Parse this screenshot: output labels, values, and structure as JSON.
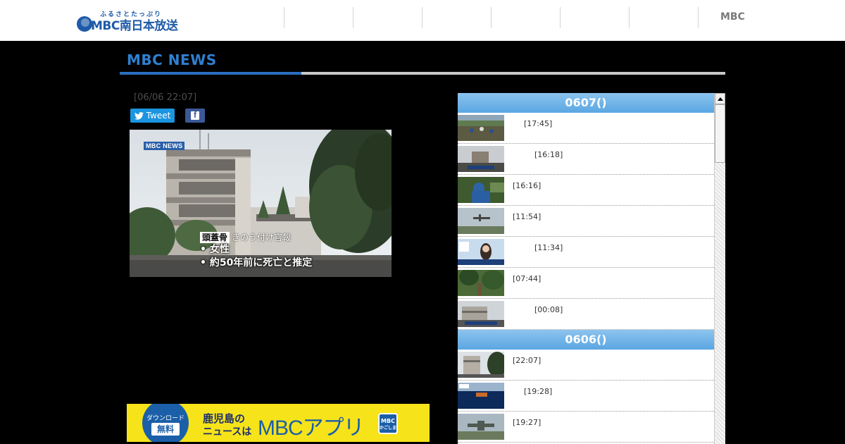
{
  "header": {
    "logo_tagline": "ふるさとたっぷり",
    "logo_name": "MBC南日本放送",
    "nav_mbc_label": "MBC"
  },
  "section": {
    "title": "MBC NEWS"
  },
  "article": {
    "date": "[06/06 22:07]",
    "tweet_label": "Tweet",
    "hero": {
      "logo_text": "MBC NEWS",
      "caption_title": "頭蓋骨",
      "caption_sub": "きのう付け官報",
      "bullet_1": "• 女性",
      "bullet_2": "• 約50年前に死亡と推定"
    }
  },
  "banner": {
    "download": "ダウンロード",
    "free": "無料",
    "line1": "鹿児島の",
    "line2": "ニュースは",
    "app": "MBCアプリ",
    "badge_top": "MBC",
    "badge_bottom": "かごしま"
  },
  "news_list": {
    "groups": [
      {
        "date": "0607()",
        "items": [
          {
            "time": "[17:45]",
            "thumb": "field"
          },
          {
            "time": "[16:18]",
            "thumb": "town"
          },
          {
            "time": "[16:16]",
            "thumb": "worker"
          },
          {
            "time": "[11:54]",
            "thumb": "plane"
          },
          {
            "time": "[11:34]",
            "thumb": "studio"
          },
          {
            "time": "[07:44]",
            "thumb": "forest"
          },
          {
            "time": "[00:08]",
            "thumb": "school"
          }
        ]
      },
      {
        "date": "0606()",
        "items": [
          {
            "time": "[22:07]",
            "thumb": "building"
          },
          {
            "time": "[19:28]",
            "thumb": "sea"
          },
          {
            "time": "[19:27]",
            "thumb": "aircraft"
          }
        ]
      }
    ]
  },
  "colors": {
    "accent_blue": "#2f7fd0",
    "day_header": "#5aa6e2",
    "banner_yellow": "#f6e31a",
    "twitter": "#1b95e0",
    "facebook": "#3b5998"
  }
}
